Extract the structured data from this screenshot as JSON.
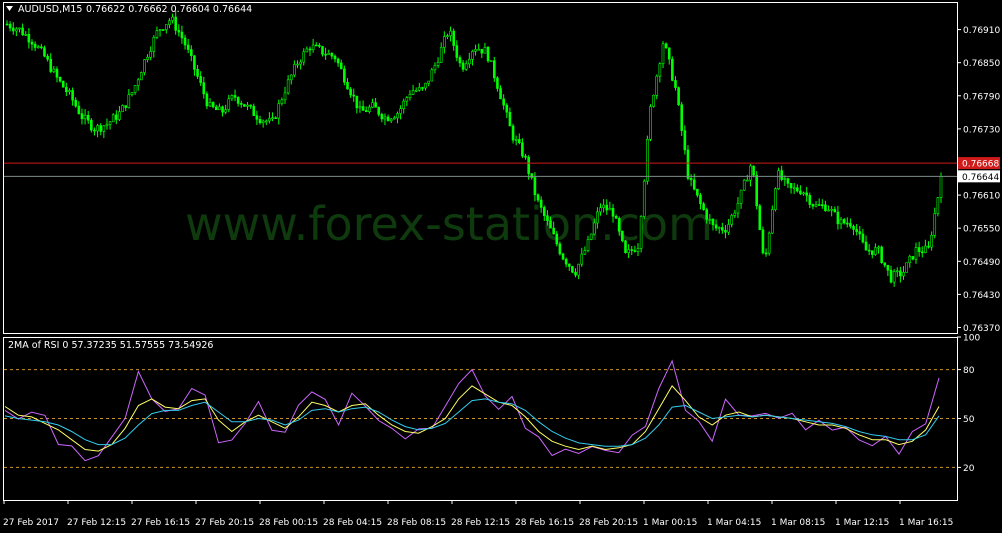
{
  "price_chart": {
    "symbol_label": "AUDUSD,M15",
    "ohlc_text": "0.76622 0.76662 0.76604 0.76644",
    "watermark": "www.forex-station.com",
    "colors": {
      "background": "#000000",
      "bars": "#00ff00",
      "grid_frame": "#ffffff",
      "ask_line": "#d11a1a",
      "bid_line": "#7c8c8c"
    },
    "badges": {
      "ask": "0.76668",
      "bid": "0.76644"
    }
  },
  "indicator": {
    "title": "2MA of RSI 0 57.37235 51.57555 73.54926",
    "levels": [
      "100",
      "80",
      "50",
      "20"
    ],
    "colors": {
      "rsi": "#cc66ff",
      "ma_fast": "#ffff66",
      "ma_slow": "#33ccee",
      "level_lines": "#c8942a"
    }
  },
  "chart_data": [
    {
      "type": "candlestick",
      "title": "AUDUSD,M15",
      "y_ticks": [
        "0.76910",
        "0.76850",
        "0.76790",
        "0.76730",
        "0.76670",
        "0.76610",
        "0.76550",
        "0.76490",
        "0.76430",
        "0.76370"
      ],
      "ylim": [
        0.7636,
        0.7696
      ],
      "horizontal_lines": {
        "ask": 0.76668,
        "bid": 0.76644
      },
      "x_ticks": [
        "27 Feb 2017",
        "27 Feb 12:15",
        "27 Feb 16:15",
        "27 Feb 20:15",
        "28 Feb 00:15",
        "28 Feb 04:15",
        "28 Feb 08:15",
        "28 Feb 12:15",
        "28 Feb 16:15",
        "28 Feb 20:15",
        "1 Mar 00:15",
        "1 Mar 04:15",
        "1 Mar 08:15",
        "1 Mar 12:15",
        "1 Mar 16:15"
      ],
      "close_path": [
        0.7692,
        0.7691,
        0.7689,
        0.7686,
        0.7682,
        0.7679,
        0.7675,
        0.7673,
        0.7674,
        0.7676,
        0.768,
        0.7686,
        0.7691,
        0.7693,
        0.7689,
        0.7683,
        0.7677,
        0.7676,
        0.7679,
        0.7677,
        0.7675,
        0.7674,
        0.768,
        0.7685,
        0.7688,
        0.7687,
        0.7686,
        0.7681,
        0.7676,
        0.7677,
        0.7675,
        0.7676,
        0.768,
        0.768,
        0.7685,
        0.7691,
        0.7684,
        0.7688,
        0.7687,
        0.768,
        0.7672,
        0.7668,
        0.766,
        0.7655,
        0.765,
        0.7647,
        0.7652,
        0.7659,
        0.7658,
        0.765,
        0.7652,
        0.7677,
        0.7689,
        0.768,
        0.7664,
        0.7659,
        0.7655,
        0.7655,
        0.766,
        0.7667,
        0.7648,
        0.7665,
        0.7662,
        0.7662,
        0.7659,
        0.7659,
        0.7656,
        0.7656,
        0.7651,
        0.7651,
        0.7646,
        0.7647,
        0.7651,
        0.7651,
        0.7664
      ],
      "series": [
        {
          "name": "Ask",
          "values": [
            0.76668
          ]
        },
        {
          "name": "Bid",
          "values": [
            0.76644
          ]
        }
      ]
    },
    {
      "type": "line",
      "title": "2MA of RSI 0 57.37235 51.57555 73.54926",
      "ylim": [
        0,
        100
      ],
      "y_ticks": [
        100,
        80,
        50,
        20
      ],
      "levels": [
        80,
        50,
        20
      ],
      "series": [
        {
          "name": "RSI",
          "values": [
            55,
            48,
            57,
            48,
            38,
            30,
            26,
            27,
            37,
            53,
            75,
            66,
            51,
            58,
            68,
            63,
            38,
            33,
            51,
            57,
            45,
            41,
            57,
            69,
            58,
            50,
            62,
            60,
            48,
            43,
            40,
            40,
            48,
            54,
            74,
            79,
            63,
            58,
            60,
            48,
            35,
            30,
            30,
            28,
            35,
            27,
            33,
            36,
            48,
            67,
            85,
            57,
            45,
            40,
            58,
            55,
            50,
            53,
            52,
            50,
            47,
            45,
            46,
            43,
            37,
            35,
            36,
            32,
            38,
            50,
            73
          ]
        },
        {
          "name": "MA fast",
          "values": [
            57.37,
            52,
            51,
            47,
            43,
            37,
            31,
            30,
            34,
            44,
            58,
            62,
            57,
            56,
            61,
            62,
            49,
            42,
            48,
            52,
            48,
            44,
            51,
            60,
            58,
            54,
            58,
            59,
            52,
            46,
            42,
            41,
            45,
            50,
            62,
            70,
            65,
            60,
            58,
            51,
            42,
            36,
            33,
            31,
            33,
            31,
            32,
            34,
            42,
            56,
            70,
            61,
            51,
            46,
            52,
            54,
            51,
            52,
            51,
            50,
            48,
            46,
            46,
            44,
            40,
            37,
            37,
            34,
            36,
            43,
            57.37
          ]
        },
        {
          "name": "MA slow",
          "values": [
            51.58,
            50,
            49,
            48,
            46,
            42,
            37,
            34,
            34,
            38,
            46,
            53,
            55,
            55,
            58,
            60,
            54,
            48,
            48,
            50,
            49,
            46,
            49,
            55,
            56,
            54,
            56,
            57,
            54,
            49,
            45,
            43,
            44,
            47,
            54,
            61,
            62,
            60,
            59,
            55,
            48,
            42,
            38,
            35,
            34,
            33,
            33,
            34,
            38,
            46,
            57,
            58,
            54,
            50,
            51,
            52,
            51,
            52,
            51,
            50,
            49,
            48,
            47,
            45,
            42,
            40,
            39,
            37,
            37,
            40,
            51.58
          ]
        }
      ]
    }
  ]
}
